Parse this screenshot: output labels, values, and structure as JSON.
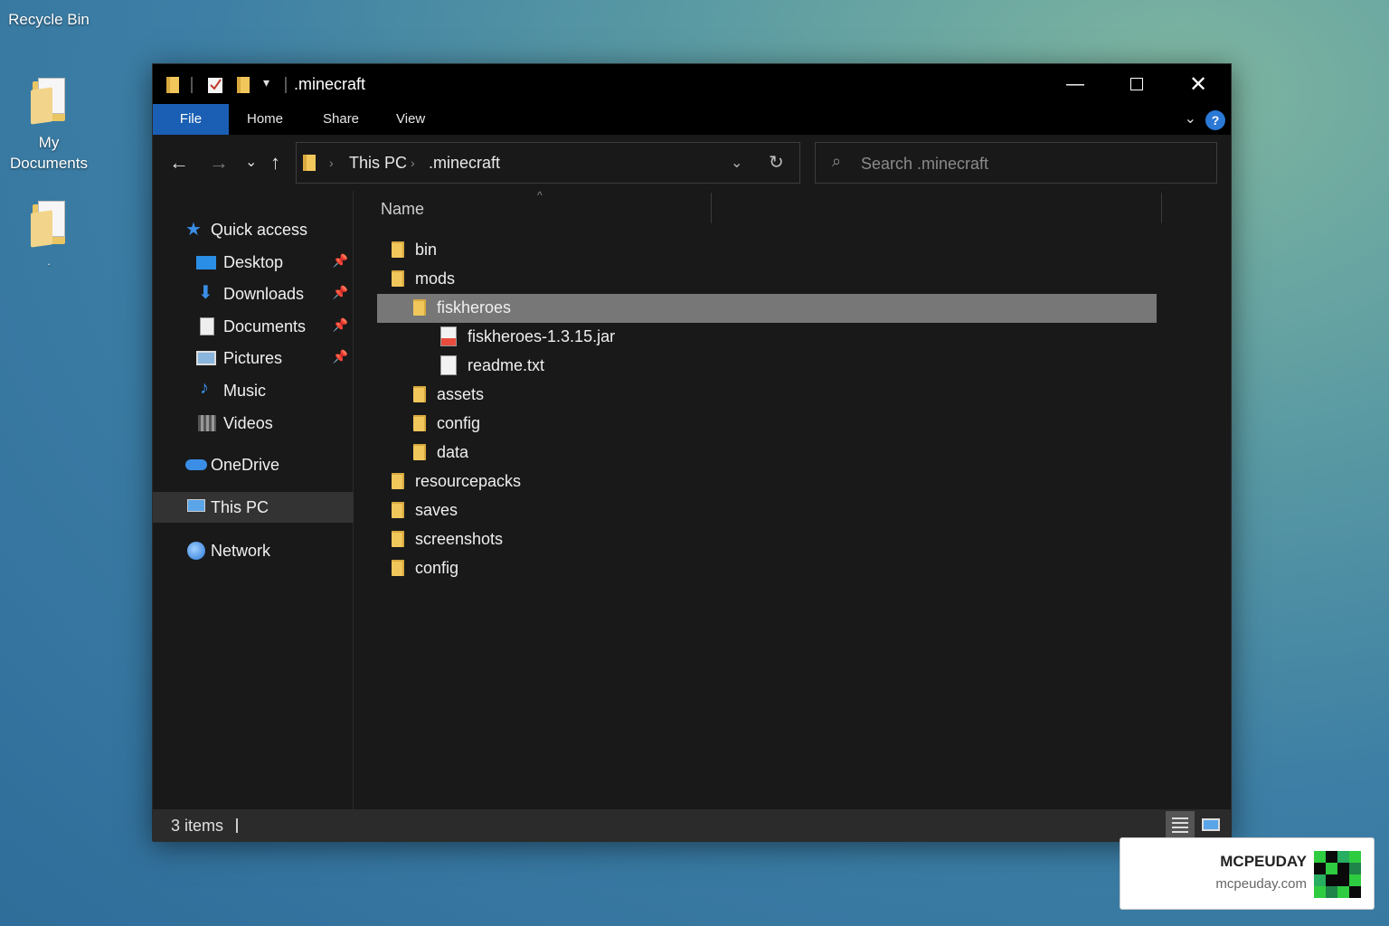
{
  "desktop": {
    "icons": [
      {
        "label": "Recycle Bin"
      },
      {
        "label": "My\nDocuments"
      },
      {
        "label": "."
      }
    ]
  },
  "window": {
    "title": ".minecraft",
    "ribbon_tabs": [
      "File",
      "Home",
      "Share",
      "View"
    ],
    "address": {
      "crumbs": [
        "This PC",
        ".minecraft"
      ]
    },
    "search": {
      "placeholder": "Search .minecraft"
    },
    "sidebar": {
      "quick_access": "Quick access",
      "items": [
        {
          "label": "Desktop",
          "icon": "desktop-icon"
        },
        {
          "label": "Downloads",
          "icon": "download-icon"
        },
        {
          "label": "Documents",
          "icon": "documents-icon"
        },
        {
          "label": "Pictures",
          "icon": "pictures-icon"
        },
        {
          "label": "Music",
          "icon": "music-icon"
        },
        {
          "label": "Videos",
          "icon": "videos-icon"
        }
      ],
      "onedrive": "OneDrive",
      "this_pc": "This PC",
      "network": "Network"
    },
    "column_header": "Name",
    "rows": [
      {
        "label": "bin",
        "type": "folder",
        "indent": 0
      },
      {
        "label": "mods",
        "type": "folder",
        "indent": 0
      },
      {
        "label": "fiskheroes",
        "type": "folder",
        "indent": 1,
        "selected": true
      },
      {
        "label": "fiskheroes-1.3.15.jar",
        "type": "jar",
        "indent": 2
      },
      {
        "label": "readme.txt",
        "type": "txt",
        "indent": 2
      },
      {
        "label": "assets",
        "type": "folder",
        "indent": 1
      },
      {
        "label": "config",
        "type": "folder",
        "indent": 1
      },
      {
        "label": "data",
        "type": "folder",
        "indent": 1
      },
      {
        "label": "resourcepacks",
        "type": "folder",
        "indent": 0
      },
      {
        "label": "saves",
        "type": "folder",
        "indent": 0
      },
      {
        "label": "screenshots",
        "type": "folder",
        "indent": 0
      },
      {
        "label": "config",
        "type": "folder",
        "indent": 0
      }
    ],
    "status": "3 items"
  },
  "watermark": {
    "brand": "MCPEUDAY",
    "site": "mcpeuday.com"
  },
  "colors": {
    "accent": "#1a5fb4",
    "folder": "#f1c75c",
    "selection": "#777777"
  }
}
